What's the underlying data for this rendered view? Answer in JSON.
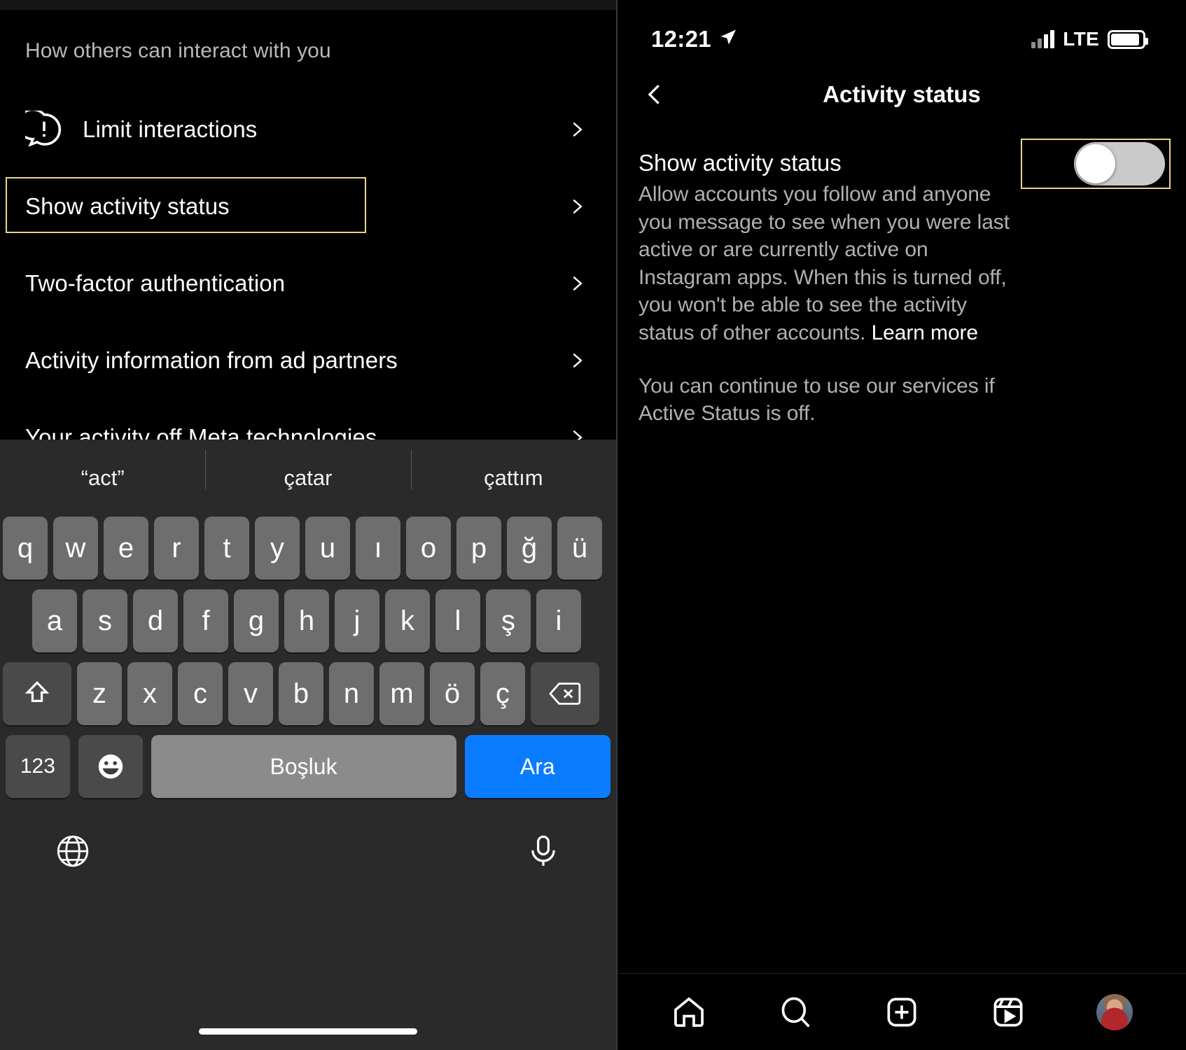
{
  "left": {
    "section_header": "How others can interact with you",
    "items": [
      {
        "label": "Limit interactions",
        "icon": "exclamation-bubble-icon",
        "chevron": "chevron-right-icon",
        "highlighted": false
      },
      {
        "label": "Show activity status",
        "icon": "none",
        "chevron": "chevron-right-icon",
        "highlighted": true
      },
      {
        "label": "Two-factor authentication",
        "icon": "none",
        "chevron": "chevron-right-icon",
        "highlighted": false
      },
      {
        "label": "Activity information from ad partners",
        "icon": "none",
        "chevron": "chevron-right-icon",
        "highlighted": false
      },
      {
        "label": "Your activity off Meta technologies",
        "icon": "none",
        "chevron": "chevron-right-icon",
        "highlighted": false
      }
    ],
    "keyboard": {
      "suggestions": [
        "“act”",
        "çatar",
        "çattım"
      ],
      "row1": [
        "q",
        "w",
        "e",
        "r",
        "t",
        "y",
        "u",
        "ı",
        "o",
        "p",
        "ğ",
        "ü"
      ],
      "row2": [
        "a",
        "s",
        "d",
        "f",
        "g",
        "h",
        "j",
        "k",
        "l",
        "ş",
        "i"
      ],
      "row3_letters": [
        "z",
        "x",
        "c",
        "v",
        "b",
        "n",
        "m",
        "ö",
        "ç"
      ],
      "shift_key": "shift-icon",
      "backspace_key": "backspace-icon",
      "numbers_key": "123",
      "emoji_key": "emoji-icon",
      "space_key": "Boşluk",
      "search_key": "Ara",
      "globe_key": "globe-icon",
      "mic_key": "microphone-icon",
      "accent_color": "#0a7cff"
    },
    "highlight_color": "#e8d48a"
  },
  "right": {
    "status_bar": {
      "time": "12:21",
      "location_icon": "location-arrow-icon",
      "signal_icon": "signal-bars-icon",
      "network": "LTE",
      "battery_icon": "battery-icon"
    },
    "header": {
      "back_icon": "chevron-left-icon",
      "title": "Activity status"
    },
    "setting": {
      "title": "Show activity status",
      "description": "Allow accounts you follow and anyone you message to see when you were last active or are currently active on Instagram apps. When this is turned off, you won't be able to see the activity status of other accounts. ",
      "learn_more": "Learn more",
      "note": "You can continue to use our services if Active Status is off.",
      "toggle_state": "off"
    },
    "tabbar": {
      "items": [
        {
          "name": "home-icon"
        },
        {
          "name": "search-icon"
        },
        {
          "name": "create-plus-icon"
        },
        {
          "name": "reels-icon"
        },
        {
          "name": "profile-avatar"
        }
      ]
    },
    "highlight_color": "#e8d48a"
  }
}
